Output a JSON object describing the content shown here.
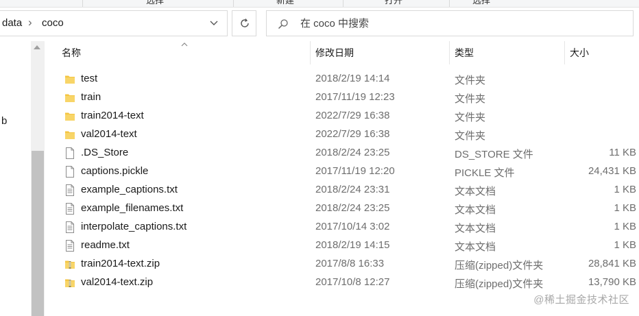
{
  "ribbon": {
    "labels": [
      "选择",
      "新建",
      "打开",
      "选择"
    ]
  },
  "address": {
    "crumbs": [
      "data",
      "coco"
    ]
  },
  "search": {
    "placeholder": "在 coco 中搜索"
  },
  "nav": {
    "partial_label": "b"
  },
  "columns": {
    "name": "名称",
    "date": "修改日期",
    "type": "类型",
    "size": "大小"
  },
  "files": [
    {
      "name": "test",
      "date": "2018/2/19 14:14",
      "type": "文件夹",
      "size": "",
      "icon": "folder-icon"
    },
    {
      "name": "train",
      "date": "2017/11/19 12:23",
      "type": "文件夹",
      "size": "",
      "icon": "folder-icon"
    },
    {
      "name": "train2014-text",
      "date": "2022/7/29 16:38",
      "type": "文件夹",
      "size": "",
      "icon": "folder-icon"
    },
    {
      "name": "val2014-text",
      "date": "2022/7/29 16:38",
      "type": "文件夹",
      "size": "",
      "icon": "folder-icon"
    },
    {
      "name": ".DS_Store",
      "date": "2018/2/24 23:25",
      "type": "DS_STORE 文件",
      "size": "11 KB",
      "icon": "blank-file-icon"
    },
    {
      "name": "captions.pickle",
      "date": "2017/11/19 12:20",
      "type": "PICKLE 文件",
      "size": "24,431 KB",
      "icon": "blank-file-icon"
    },
    {
      "name": "example_captions.txt",
      "date": "2018/2/24 23:31",
      "type": "文本文档",
      "size": "1 KB",
      "icon": "text-file-icon"
    },
    {
      "name": "example_filenames.txt",
      "date": "2018/2/24 23:25",
      "type": "文本文档",
      "size": "1 KB",
      "icon": "text-file-icon"
    },
    {
      "name": "interpolate_captions.txt",
      "date": "2017/10/14 3:02",
      "type": "文本文档",
      "size": "1 KB",
      "icon": "text-file-icon"
    },
    {
      "name": "readme.txt",
      "date": "2018/2/19 14:15",
      "type": "文本文档",
      "size": "1 KB",
      "icon": "text-file-icon"
    },
    {
      "name": "train2014-text.zip",
      "date": "2017/8/8 16:33",
      "type": "压缩(zipped)文件夹",
      "size": "28,841 KB",
      "icon": "zip-folder-icon"
    },
    {
      "name": "val2014-text.zip",
      "date": "2017/10/8 12:27",
      "type": "压缩(zipped)文件夹",
      "size": "13,790 KB",
      "icon": "zip-folder-icon"
    }
  ],
  "watermark": "@稀土掘金技术社区",
  "colors": {
    "folder": "#f4c542",
    "muted_text": "#6d6d6d",
    "border": "#d9d9d9"
  }
}
